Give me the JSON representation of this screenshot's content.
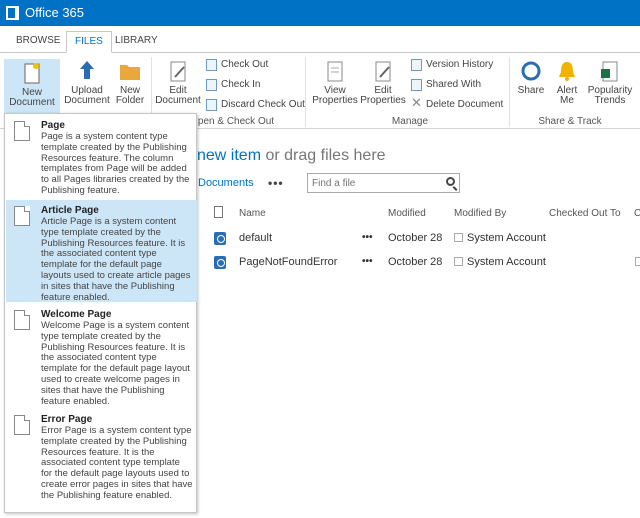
{
  "suite": {
    "title": "Office 365"
  },
  "tabs": [
    {
      "label": "BROWSE"
    },
    {
      "label": "FILES"
    },
    {
      "label": "LIBRARY"
    }
  ],
  "ribbon": {
    "new_document": "New\nDocument",
    "new_document_l1": "New",
    "new_document_l2": "Document",
    "upload_l1": "Upload",
    "upload_l2": "Document",
    "folder_l1": "New",
    "folder_l2": "Folder",
    "edit_doc_l1": "Edit",
    "edit_doc_l2": "Document",
    "check_out": "Check Out",
    "check_in": "Check In",
    "discard_check_out": "Discard Check Out",
    "group_open_check": "pen & Check Out",
    "view_props_l1": "View",
    "view_props_l2": "Properties",
    "edit_props_l1": "Edit",
    "edit_props_l2": "Properties",
    "version_history": "Version History",
    "shared_with": "Shared With",
    "delete_document": "Delete Document",
    "group_manage": "Manage",
    "share": "Share",
    "alert_l1": "Alert",
    "alert_l2": "Me",
    "popularity_l1": "Popularity",
    "popularity_l2": "Trends",
    "group_share_track": "Share & Track"
  },
  "main": {
    "hero_link": "new item",
    "hero_rest": " or drag files here",
    "documents_link": "Documents",
    "more": "•••",
    "search_placeholder": "Find a file"
  },
  "columns": {
    "name": "Name",
    "modified": "Modified",
    "modified_by": "Modified By",
    "checked_out_to": "Checked Out To",
    "cut": "C"
  },
  "rows": [
    {
      "name": "default",
      "more": "•••",
      "modified": "October 28",
      "modified_by": "System Account"
    },
    {
      "name": "PageNotFoundError",
      "more": "•••",
      "modified": "October 28",
      "modified_by": "System Account"
    }
  ],
  "menu": {
    "items": [
      {
        "title": "Page",
        "desc": "Page is a system content type template created by the Publishing Resources feature. The column templates from Page will be added to all Pages libraries created by the Publishing feature."
      },
      {
        "title": "Article Page",
        "desc": "Article Page is a system content type template created by the Publishing Resources feature. It is the associated content type template for the default page layouts used to create article pages in sites that have the Publishing feature enabled."
      },
      {
        "title": "Welcome Page",
        "desc": "Welcome Page is a system content type template created by the Publishing Resources feature. It is the associated content type template for the default page layout used to create welcome pages in sites that have the Publishing feature enabled."
      },
      {
        "title": "Error Page",
        "desc": "Error Page is a system content type template created by the Publishing Resources feature. It is the associated content type template for the default page layouts used to create error pages in sites that have the Publishing feature enabled."
      }
    ]
  },
  "colors": {
    "accent": "#0072c6",
    "highlight": "#cde6f7"
  }
}
